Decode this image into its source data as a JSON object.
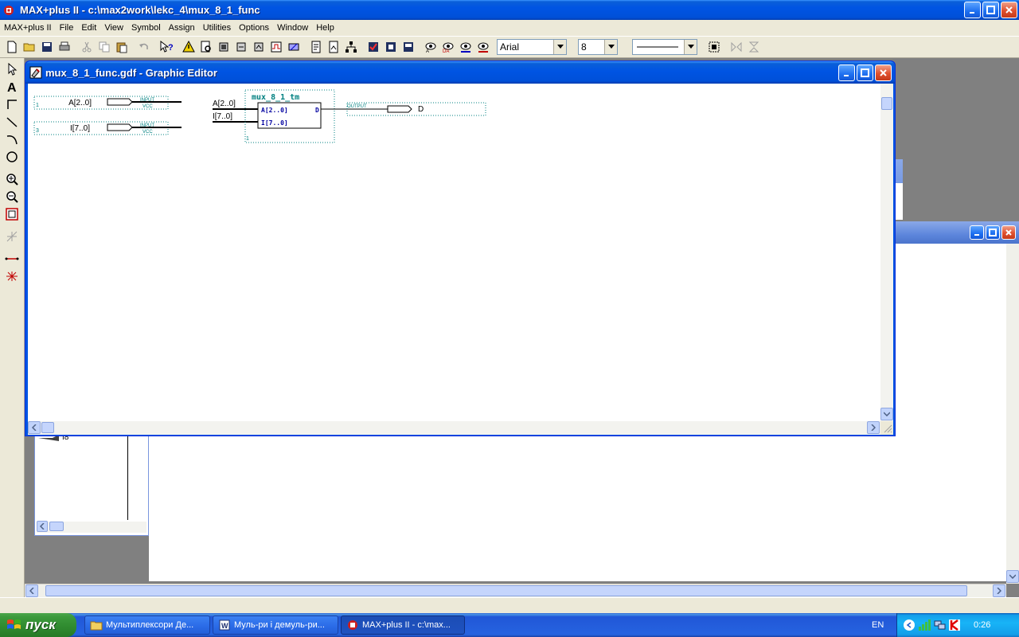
{
  "app": {
    "title": "MAX+plus II - c:\\max2work\\lekc_4\\mux_8_1_func"
  },
  "menu": [
    "MAX+plus II",
    "File",
    "Edit",
    "View",
    "Symbol",
    "Assign",
    "Utilities",
    "Options",
    "Window",
    "Help"
  ],
  "toolbar": {
    "font_name": "Arial",
    "font_size": "8"
  },
  "editor": {
    "title": "mux_8_1_func.gdf - Graphic Editor"
  },
  "schematic": {
    "inputs": [
      {
        "name": "A[2..0]",
        "type": "INPUT",
        "vcc": "VCC",
        "num": "1"
      },
      {
        "name": "I[7..0]",
        "type": "INPUT",
        "vcc": "VCC",
        "num": "3"
      }
    ],
    "block": {
      "name": "mux_8_1_tm",
      "port_a": "A[2..0]",
      "port_i": "I[7..0]",
      "port_d": "D",
      "num": "1"
    },
    "wire_labels": [
      "A[2..0]",
      "I[7..0]"
    ],
    "output": {
      "type": "OUTPUT",
      "name": "D"
    }
  },
  "bg_window": {
    "label": "I8"
  },
  "taskbar": {
    "start": "пуск",
    "tasks": [
      {
        "label": "Мультиплексори Де..."
      },
      {
        "label": "Муль-ри і демуль-ри..."
      },
      {
        "label": "MAX+plus II - c:\\max..."
      }
    ],
    "lang": "EN",
    "clock": "0:26"
  },
  "colors": {
    "xp_blue": "#0054e3",
    "schematic_teal": "#008080",
    "block_blue": "#0000a0"
  }
}
